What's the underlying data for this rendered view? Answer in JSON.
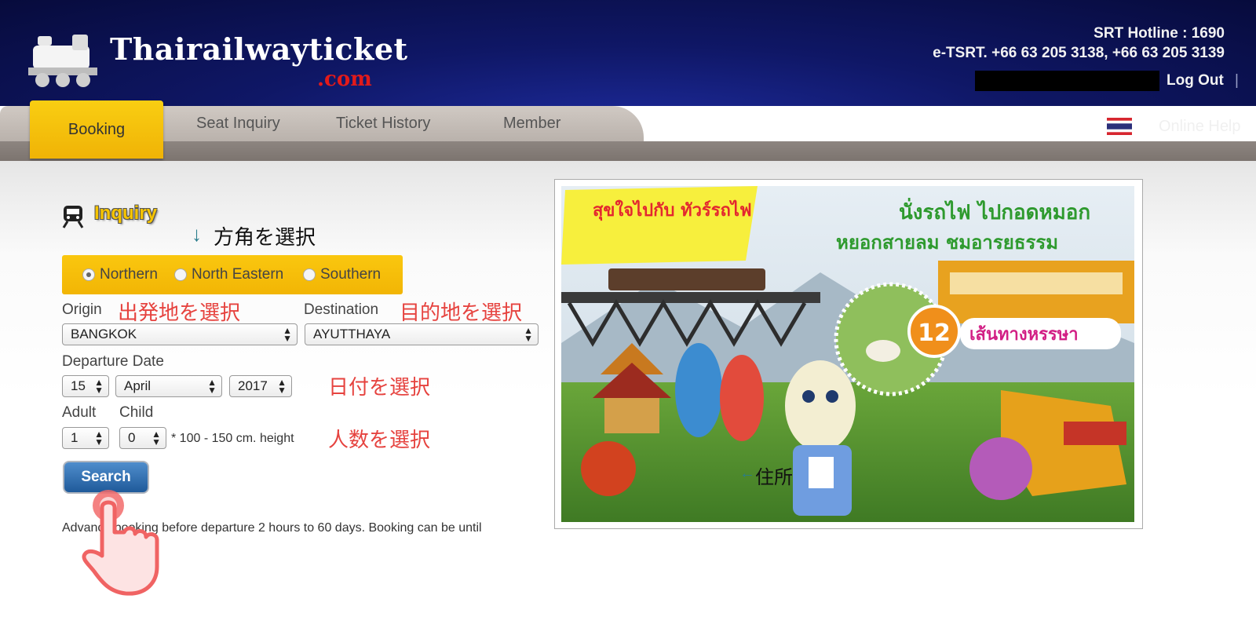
{
  "header": {
    "logo_text": "Thairailwayticket",
    "logo_suffix": ".com",
    "hotline_line1": "SRT Hotline : 1690",
    "hotline_line2": "e-TSRT. +66 63 205 3138, +66 63 205 3139",
    "logout_label": "Log Out",
    "logout_separator": "|"
  },
  "nav": {
    "tabs": [
      "Booking",
      "Seat Inquiry",
      "Ticket History",
      "Member"
    ],
    "active_tab": "Booking",
    "online_help": "Online Help",
    "flag_icon": "thai-flag-icon"
  },
  "inquiry": {
    "title": "Inquiry",
    "regions": [
      {
        "label": "Northern",
        "selected": true
      },
      {
        "label": "North Eastern",
        "selected": false
      },
      {
        "label": "Southern",
        "selected": false
      }
    ],
    "origin_label": "Origin",
    "origin_value": "BANGKOK",
    "destination_label": "Destination",
    "destination_value": "AYUTTHAYA",
    "departure_label": "Departure Date",
    "day_value": "15",
    "month_value": "April",
    "year_value": "2017",
    "adult_label": "Adult",
    "child_label": "Child",
    "adult_value": "1",
    "child_value": "0",
    "height_note": "* 100 - 150 cm. height",
    "search_label": "Search",
    "booking_note": "Advance booking before departure 2 hours to 60 days. Booking can be until"
  },
  "annotations": {
    "direction_arrow": "↓",
    "direction": "方角を選択",
    "origin": "出発地を選択",
    "destination": "目的地を選択",
    "date": "日付を選択",
    "people": "人数を選択",
    "address_arrow": "←",
    "address": "住所"
  },
  "banner": {
    "top_left": "สุขใจไปกับ ทัวร์รถไฟ",
    "top_right_1": "นั่งรถไฟ ไปกอดหมอก",
    "top_right_2": "หยอกสายลม ชมอารยธรรม",
    "badge_number": "12",
    "badge_text": "เส้นทางหรรษา"
  },
  "colors": {
    "header_bg": "#0f1766",
    "accent_yellow": "#f4b806",
    "annotation_red": "#e6433f",
    "search_blue": "#2a6cb0"
  }
}
